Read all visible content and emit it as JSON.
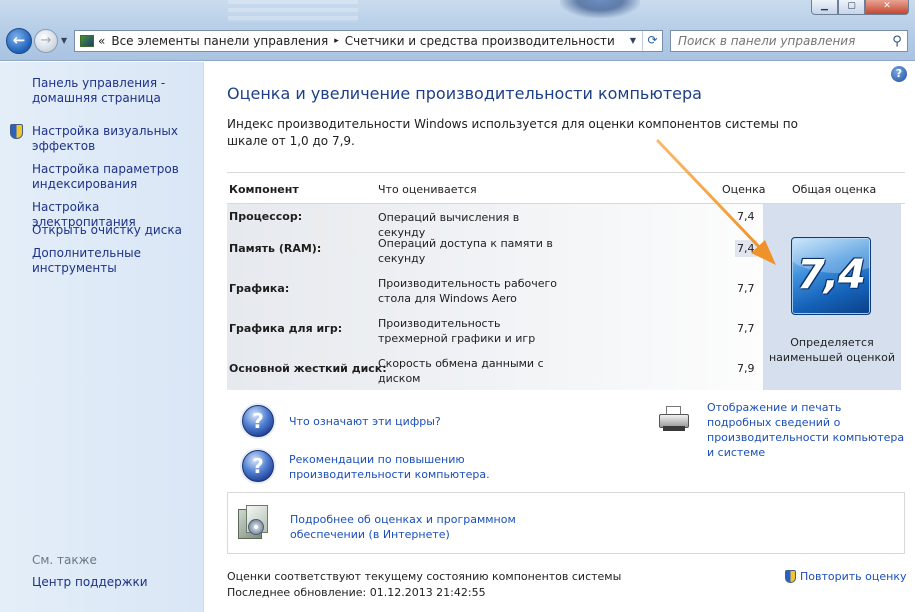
{
  "window": {
    "minimize_label": "▁",
    "maximize_label": "▢",
    "close_label": "✕"
  },
  "address_bar": {
    "overflow_label": "«",
    "breadcrumbs": [
      "Все элементы панели управления",
      "Счетчики и средства производительности"
    ],
    "separator": "▸"
  },
  "search": {
    "placeholder": "Поиск в панели управления"
  },
  "icons": {
    "back": "back-arrow-icon",
    "forward": "forward-arrow-icon",
    "refresh": "refresh-icon",
    "search": "search-icon",
    "help": "help-icon",
    "shield": "uac-shield-icon",
    "question": "question-icon",
    "printer": "printer-icon",
    "software": "software-box-icon"
  },
  "sidebar": {
    "items": [
      "Панель управления - домашняя страница",
      "Настройка визуальных эффектов",
      "Настройка параметров индексирования",
      "Настройка электропитания",
      "Открыть очистку диска",
      "Дополнительные инструменты"
    ],
    "see_also_title": "См. также",
    "see_also_items": [
      "Центр поддержки"
    ]
  },
  "main": {
    "title": "Оценка и увеличение производительности компьютера",
    "intro": "Индекс производительности Windows используется для оценки компонентов системы по шкале от 1,0 до 7,9.",
    "table": {
      "headers": {
        "component": "Компонент",
        "what": "Что оценивается",
        "score": "Оценка",
        "overall": "Общая оценка"
      },
      "rows": [
        {
          "component": "Процессор:",
          "description": "Операций вычисления в секунду",
          "score": "7,4"
        },
        {
          "component": "Память (RAM):",
          "description": "Операций доступа к памяти в секунду",
          "score": "7,4"
        },
        {
          "component": "Графика:",
          "description": "Производительность рабочего стола для Windows Aero",
          "score": "7,7"
        },
        {
          "component": "Графика для игр:",
          "description": "Производительность трехмерной графики и игр",
          "score": "7,7"
        },
        {
          "component": "Основной жесткий диск:",
          "description": "Скорость обмена данными с диском",
          "score": "7,9"
        }
      ],
      "overall_score": "7,4",
      "overall_caption": "Определяется наименьшей оценкой"
    },
    "links": {
      "what_numbers_mean": "Что означают эти цифры?",
      "recommendations": "Рекомендации по повышению производительности компьютера.",
      "print_details": "Отображение и печать подробных сведений о производительности компьютера и системе",
      "online_info": "Подробнее об оценках и программном обеспечении (в Интернете)"
    },
    "status_line": "Оценки соответствуют текущему состоянию компонентов системы",
    "last_update": "Последнее обновление: 01.12.2013 21:42:55",
    "reassess_label": "Повторить оценку"
  },
  "colors": {
    "link": "#1a4fb8",
    "title": "#1e3f87",
    "annotation_arrow": "#f0922a"
  }
}
